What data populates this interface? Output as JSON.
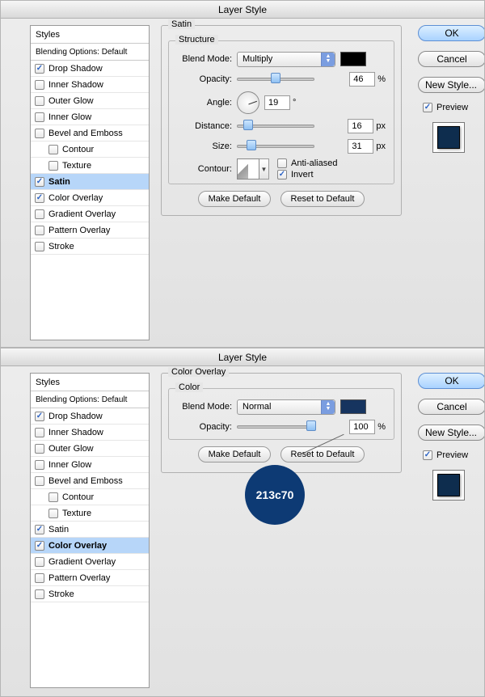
{
  "dialog1": {
    "title": "Layer Style",
    "styles_header": "Styles",
    "blending_options": "Blending Options: Default",
    "items": [
      {
        "label": "Drop Shadow",
        "checked": true,
        "indent": false,
        "selected": false
      },
      {
        "label": "Inner Shadow",
        "checked": false,
        "indent": false,
        "selected": false
      },
      {
        "label": "Outer Glow",
        "checked": false,
        "indent": false,
        "selected": false
      },
      {
        "label": "Inner Glow",
        "checked": false,
        "indent": false,
        "selected": false
      },
      {
        "label": "Bevel and Emboss",
        "checked": false,
        "indent": false,
        "selected": false
      },
      {
        "label": "Contour",
        "checked": false,
        "indent": true,
        "selected": false
      },
      {
        "label": "Texture",
        "checked": false,
        "indent": true,
        "selected": false
      },
      {
        "label": "Satin",
        "checked": true,
        "indent": false,
        "selected": true
      },
      {
        "label": "Color Overlay",
        "checked": true,
        "indent": false,
        "selected": false
      },
      {
        "label": "Gradient Overlay",
        "checked": false,
        "indent": false,
        "selected": false
      },
      {
        "label": "Pattern Overlay",
        "checked": false,
        "indent": false,
        "selected": false
      },
      {
        "label": "Stroke",
        "checked": false,
        "indent": false,
        "selected": false
      }
    ],
    "section_title": "Satin",
    "structure_title": "Structure",
    "labels": {
      "blend_mode": "Blend Mode:",
      "opacity": "Opacity:",
      "angle": "Angle:",
      "distance": "Distance:",
      "size": "Size:",
      "contour": "Contour:",
      "antialiased": "Anti-aliased",
      "invert": "Invert"
    },
    "values": {
      "blend_mode": "Multiply",
      "opacity": "46",
      "angle": "19",
      "distance": "16",
      "size": "31",
      "antialiased": false,
      "invert": true
    },
    "units": {
      "pct": "%",
      "deg": "°",
      "px": "px"
    },
    "buttons": {
      "make_default": "Make Default",
      "reset": "Reset to Default"
    },
    "side": {
      "ok": "OK",
      "cancel": "Cancel",
      "new_style": "New Style...",
      "preview": "Preview"
    }
  },
  "dialog2": {
    "title": "Layer Style",
    "styles_header": "Styles",
    "blending_options": "Blending Options: Default",
    "items": [
      {
        "label": "Drop Shadow",
        "checked": true,
        "indent": false,
        "selected": false
      },
      {
        "label": "Inner Shadow",
        "checked": false,
        "indent": false,
        "selected": false
      },
      {
        "label": "Outer Glow",
        "checked": false,
        "indent": false,
        "selected": false
      },
      {
        "label": "Inner Glow",
        "checked": false,
        "indent": false,
        "selected": false
      },
      {
        "label": "Bevel and Emboss",
        "checked": false,
        "indent": false,
        "selected": false
      },
      {
        "label": "Contour",
        "checked": false,
        "indent": true,
        "selected": false
      },
      {
        "label": "Texture",
        "checked": false,
        "indent": true,
        "selected": false
      },
      {
        "label": "Satin",
        "checked": true,
        "indent": false,
        "selected": false
      },
      {
        "label": "Color Overlay",
        "checked": true,
        "indent": false,
        "selected": true
      },
      {
        "label": "Gradient Overlay",
        "checked": false,
        "indent": false,
        "selected": false
      },
      {
        "label": "Pattern Overlay",
        "checked": false,
        "indent": false,
        "selected": false
      },
      {
        "label": "Stroke",
        "checked": false,
        "indent": false,
        "selected": false
      }
    ],
    "section_title": "Color Overlay",
    "sub_title": "Color",
    "labels": {
      "blend_mode": "Blend Mode:",
      "opacity": "Opacity:"
    },
    "values": {
      "blend_mode": "Normal",
      "opacity": "100"
    },
    "units": {
      "pct": "%"
    },
    "buttons": {
      "make_default": "Make Default",
      "reset": "Reset to Default"
    },
    "side": {
      "ok": "OK",
      "cancel": "Cancel",
      "new_style": "New Style...",
      "preview": "Preview"
    },
    "callout_hex": "213c70"
  }
}
